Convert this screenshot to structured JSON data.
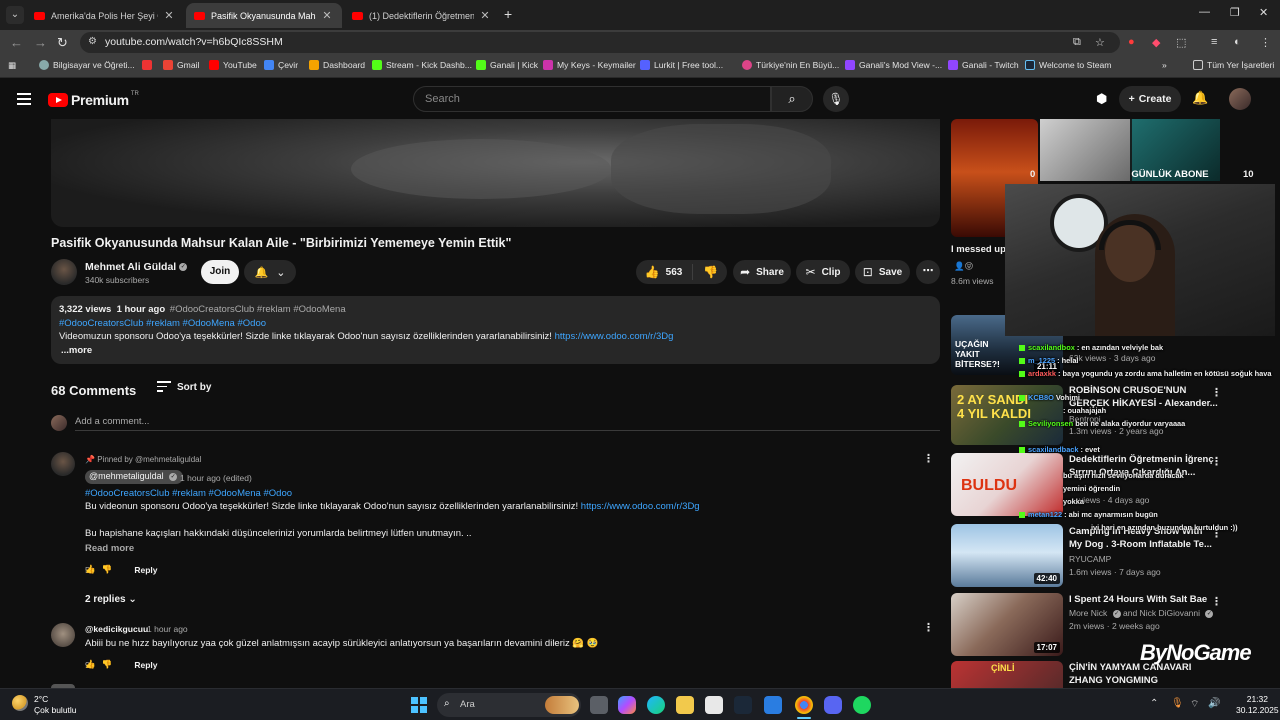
{
  "browser": {
    "tabs": [
      {
        "title": "Amerika'da Polis Her Şeyi Görüy",
        "active": false
      },
      {
        "title": "Pasifik Okyanusunda Mahsur Kal",
        "active": true
      },
      {
        "title": "(1) Dedektiflerin Öğretmenin İğre",
        "active": false
      }
    ],
    "url": "youtube.com/watch?v=h6bQIc8SSHM",
    "bookmarks": [
      "Bilgisayar ve Öğreti...",
      "Gmail",
      "YouTube",
      "Çevir",
      "Dashboard",
      "Stream - Kick Dashb...",
      "Ganali | Kick",
      "My Keys - Keymailer",
      "Lurkit | Free tool...",
      "Türkiye'nin En Büyü...",
      "Ganali's Mod View -...",
      "Ganali - Twitch",
      "Welcome to Steam"
    ],
    "all_bookmarks": "Tüm Yer İşaretleri"
  },
  "youtube": {
    "logo_text": "Premium",
    "logo_mark": "TR",
    "search_placeholder": "Search",
    "create_label": "Create"
  },
  "video": {
    "title": "Pasifik Okyanusunda Mahsur Kalan Aile - \"Birbirimizi Yememeye Yemin Ettik\"",
    "channel": "Mehmet Ali Güldal",
    "subscribers": "340k subscribers",
    "join_label": "Join",
    "likes": "563",
    "share_label": "Share",
    "clip_label": "Clip",
    "save_label": "Save",
    "views": "3,322 views",
    "age": "1 hour ago",
    "meta_tags": "#OdooCreatorsClub #reklam #OdooMena",
    "desc_tags": "#OdooCreatorsClub #reklam #OdooMena #Odoo",
    "desc_text": "Videomuzun sponsoru Odoo'ya teşekkürler! Sizde linke tıklayarak Odoo'nun sayısız özelliklerinden yararlanabilirsiniz!",
    "desc_link": "https://www.odoo.com/r/3Dg",
    "more_label": "...more"
  },
  "comments": {
    "count_label": "68 Comments",
    "sort_label": "Sort by",
    "add_placeholder": "Add a comment...",
    "pinned_label": "Pinned by @mehmetaliguldal",
    "items": [
      {
        "author": "@mehmetaliguldal",
        "time": "1 hour ago (edited)",
        "tags": "#OdooCreatorsClub #reklam #OdooMena #Odoo",
        "text": "Bu videonun sponsoru Odoo'ya teşekkürler! Sizde linke tıklayarak Odoo'nun sayısız özelliklerinden yararlanabilirsiniz!",
        "link": "https://www.odoo.com/r/3Dg",
        "text2": "Bu hapishane kaçışları hakkındaki düşüncelerinizi yorumlarda belirtmeyi lütfen unutmayın. ..",
        "read_more": "Read more",
        "likes": "5",
        "reply_label": "Reply",
        "replies_label": "2 replies"
      },
      {
        "author": "@kedicikgucuu",
        "time": "1 hour ago",
        "text": "Abiii bu ne hızz bayılıyoruz yaa  çok güzel anlatmışsın acayip sürükleyici anlatıyorsun ya başarıların devamini dileriz 🤗 🥹",
        "likes": "9",
        "reply_label": "Reply"
      }
    ]
  },
  "sidebar": {
    "top_title": "I messed up",
    "top_views": "8.6m views",
    "videos": [
      {
        "title": "",
        "channel": "",
        "meta": "63k views · 3 days ago",
        "duration": "21:11",
        "thumb_text": "UÇAĞIN YAKIT BİTERSE?!"
      },
      {
        "title": "ROBİNSON CRUSOE'NUN",
        "title2": "GERÇEK HİKAYESİ - Alexander...",
        "channel": "Bentropi",
        "meta": "1.3m views · 2 years ago",
        "thumb_text": "2 AY SANDI 4 YIL KALDI"
      },
      {
        "title": "Dedektiflerin Öğretmenin İğrenç",
        "title2": "Sırrını Ortaya Çıkardığı An...",
        "channel": "",
        "meta": "views · 4 days ago",
        "thumb_text": "BULDU"
      },
      {
        "title": "Camping in Heavy Snow With",
        "title2": "My Dog . 3-Room Inflatable Te...",
        "channel": "RYUCAMP",
        "meta": "1.6m views · 7 days ago",
        "duration": "42:40"
      },
      {
        "title": "I Spent 24 Hours With Salt Bae",
        "channel": "More Nick",
        "channel2": "and Nick DiGiovanni",
        "meta": "2m views · 2 weeks ago",
        "duration": "17:07"
      },
      {
        "title": "ÇİN'İN YAMYAM CANAVARI",
        "title2": "ZHANG YONGMING",
        "thumb_text": "ÇİNLİ"
      }
    ]
  },
  "stream_overlay": {
    "abone_label": "GÜNLÜK ABONE",
    "left_stat": "0",
    "right_stat": "10",
    "brand": "ByNoGame",
    "chat": [
      {
        "user": "scaxilandbox",
        "msg": ": en azından velviyle bak"
      },
      {
        "user": "m_1225",
        "msg": ": helal"
      },
      {
        "user": "ardaxkk",
        "msg": ": baya yogundu ya zordu ama halletim en kötüsü soğuk hava"
      },
      {
        "user": "KCB8O",
        "msg": "Vohimi"
      },
      {
        "user": "",
        "msg": ": ouahajajah"
      },
      {
        "user": "Seviliyonsen",
        "msg": "ben ne alaka diyordur varyaaaa"
      },
      {
        "user": "scaxilandback",
        "msg": ": evet"
      },
      {
        "user": "",
        "msg": "bu aşırı hızlı sevilyorlarda duracak"
      },
      {
        "user": "",
        "msg": "yemini öğrendin"
      },
      {
        "user": "",
        "msg": "yokka"
      },
      {
        "user": "metan122",
        "msg": ": abi mc aynarmısın bugün"
      },
      {
        "user": "",
        "msg": "ivi hari en azından buzundan kurtuldun :))"
      }
    ]
  },
  "taskbar": {
    "temp": "2°C",
    "weather": "Çok bulutlu",
    "search_label": "Ara",
    "time": "21:32",
    "date": "30.12.2025"
  }
}
